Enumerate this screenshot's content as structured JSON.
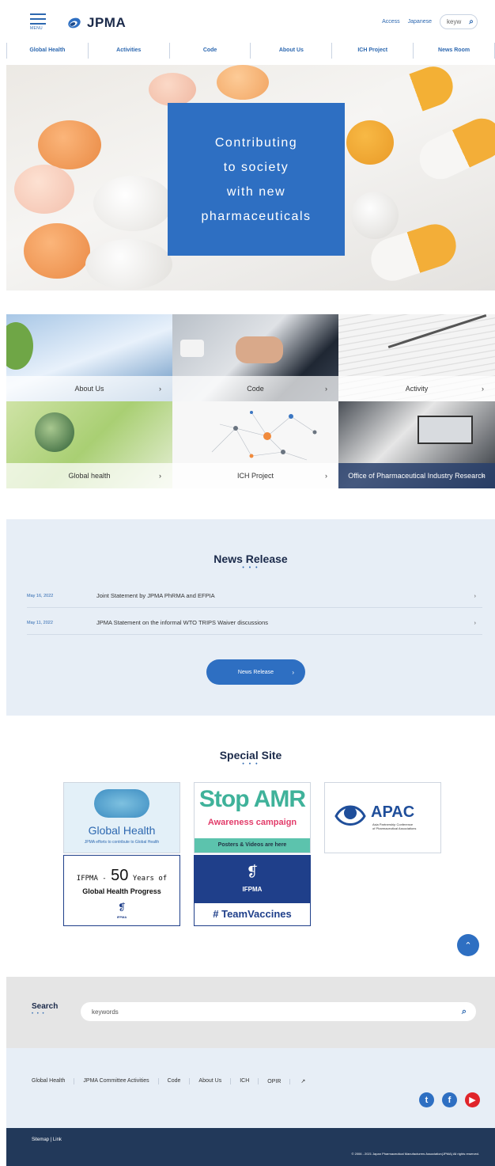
{
  "header": {
    "menu_label": "MENU",
    "logo_text": "JPMA",
    "access": "Access",
    "language": "Japanese",
    "search_placeholder": "keyw"
  },
  "nav": [
    "Global Health",
    "Activities",
    "Code",
    "About Us",
    "ICH Project",
    "News Room"
  ],
  "hero": {
    "lines": [
      "Contributing",
      "to society",
      "with new",
      "pharmaceuticals"
    ]
  },
  "categories": [
    {
      "label": "About Us"
    },
    {
      "label": "Code"
    },
    {
      "label": "Activity"
    },
    {
      "label": "Global health"
    },
    {
      "label": "ICH Project"
    },
    {
      "label": "Office of Pharmaceutical Industry Research"
    }
  ],
  "news": {
    "title": "News Release",
    "items": [
      {
        "date": "May 16, 2022",
        "title": "Joint Statement by JPMA PhRMA and EFPIA"
      },
      {
        "date": "May 11, 2022",
        "title": "JPMA Statement on the informal WTO TRIPS Waiver discussions"
      }
    ],
    "button": "News Release"
  },
  "special": {
    "title": "Special Site",
    "banners": {
      "global_health_title": "Global Health",
      "global_health_sub": "JPMA efforts to contribute to Global Health",
      "amr_title": "Stop AMR",
      "amr_sub": "Awareness campaign",
      "amr_foot": "Posters & Videos are here",
      "apac_title": "APAC",
      "apac_sub1": "Asia Partnership Conference",
      "apac_sub2": "of Pharmaceutical Associations",
      "ifpma_prefix": "IFPMA -",
      "ifpma_num": "50",
      "ifpma_suffix": "Years of",
      "ifpma_line2": "Global Health Progress",
      "ifpma_logo": "IFPMA",
      "vaccines_org": "IFPMA",
      "vaccines_tag": "# TeamVaccines"
    }
  },
  "search": {
    "label": "Search",
    "placeholder": "keywords"
  },
  "footer": {
    "links": [
      "Global Health",
      "JPMA Committee Activities",
      "Code",
      "About Us",
      "ICH",
      "OPIR"
    ],
    "bottom_links": "Sitemap   |   Link",
    "copyright": "© 2006 - 2021 Japan Pharmaceutical Manufacturers Association(JPMA) All rights reserved."
  },
  "colors": {
    "brand_blue": "#2e6fc2",
    "navy": "#22395a",
    "light_bg": "#e7eef6"
  }
}
